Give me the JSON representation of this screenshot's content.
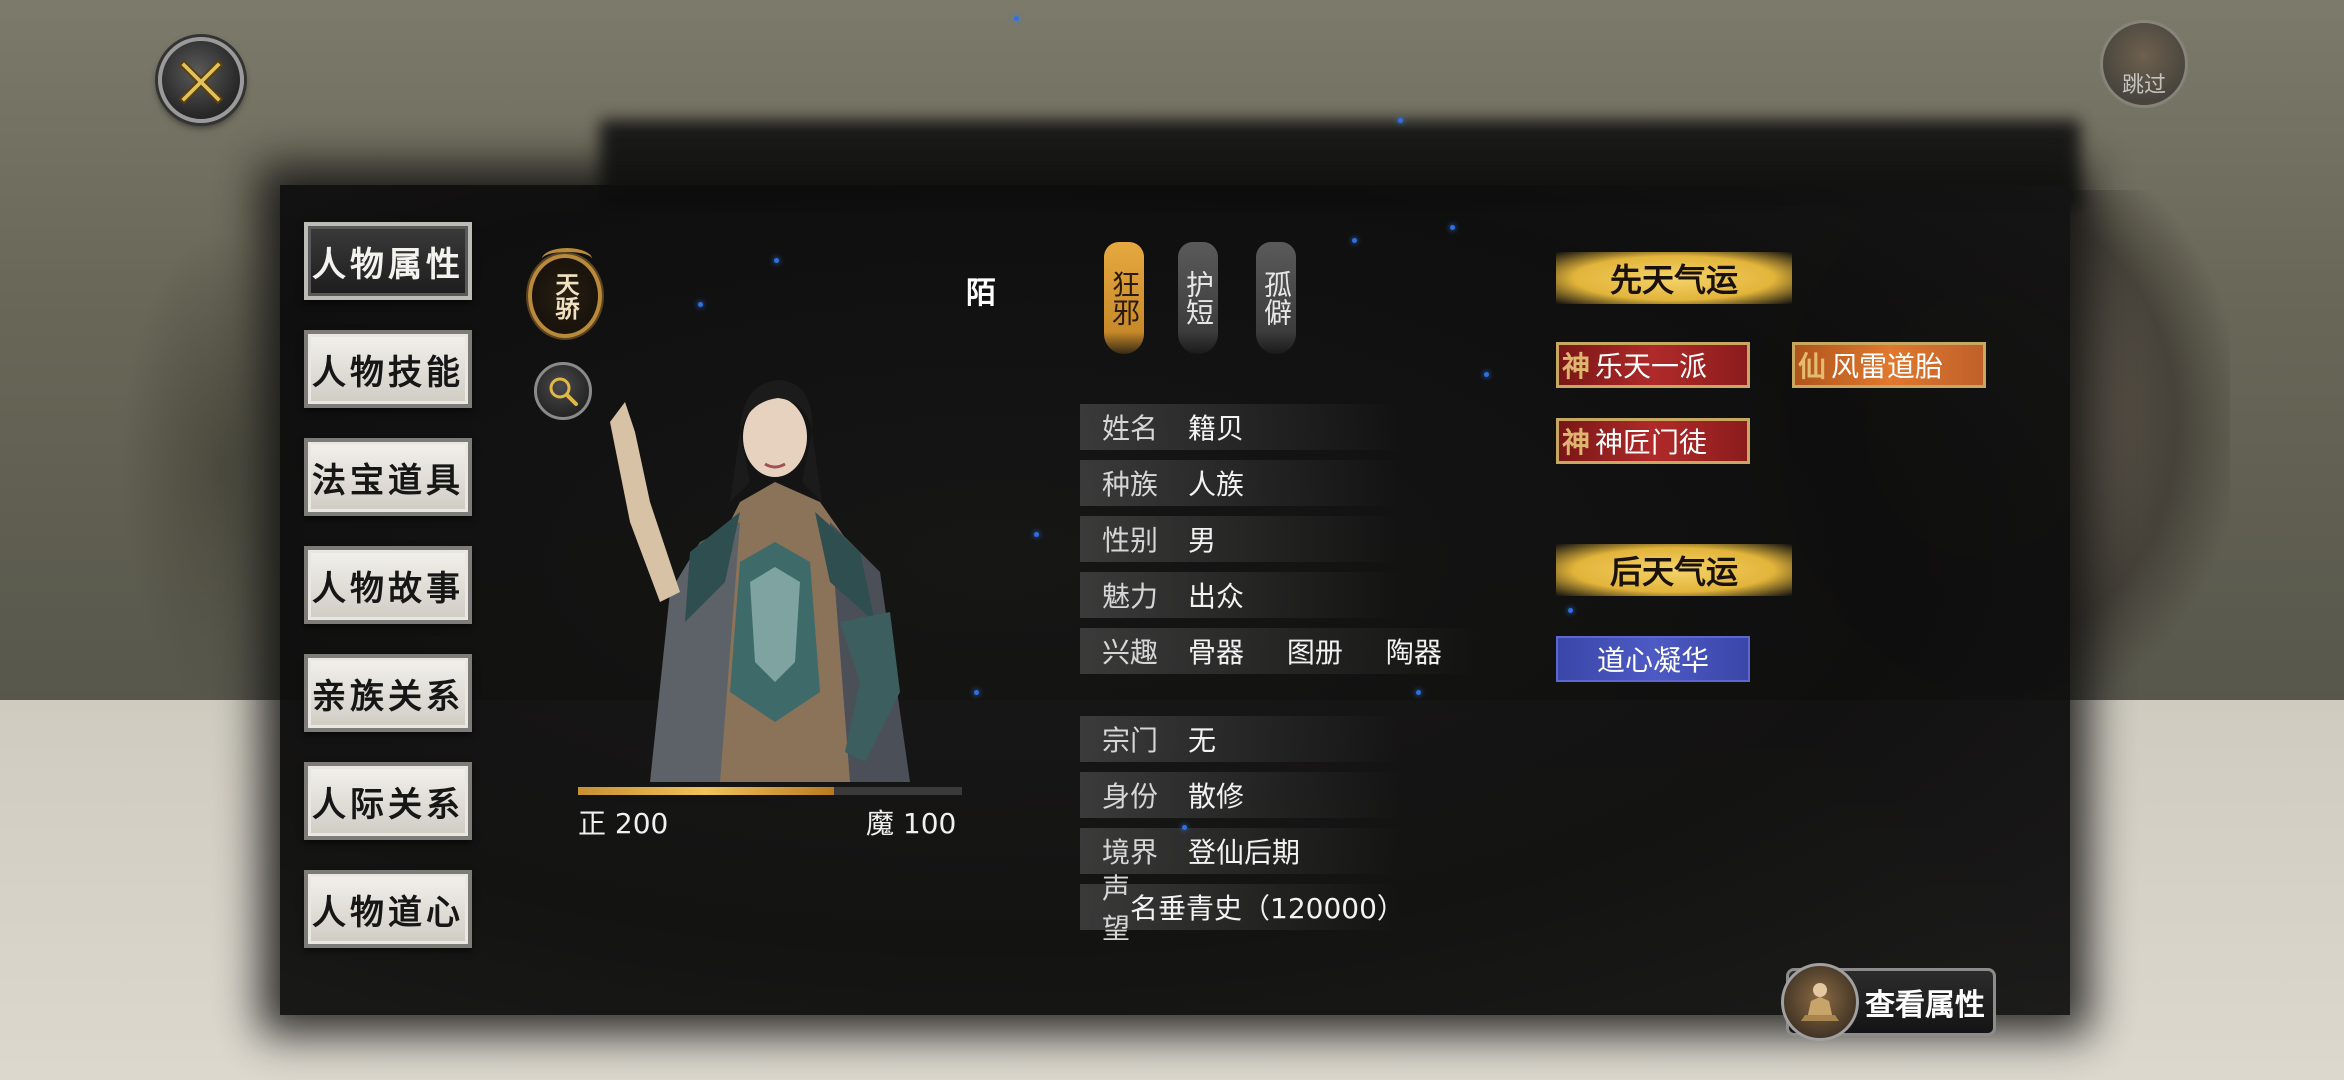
{
  "menu": {
    "items": [
      {
        "label": "人物属性",
        "active": true
      },
      {
        "label": "人物技能",
        "active": false
      },
      {
        "label": "法宝道具",
        "active": false
      },
      {
        "label": "人物故事",
        "active": false
      },
      {
        "label": "亲族关系",
        "active": false
      },
      {
        "label": "人际关系",
        "active": false
      },
      {
        "label": "人物道心",
        "active": false
      }
    ]
  },
  "header": {
    "skip_label": "跳过",
    "badge_label": "天骄",
    "surname_glyph": "陌"
  },
  "morality": {
    "left_label": "正 200",
    "right_label": "魔 100",
    "left_value": 200,
    "right_value": 100
  },
  "traits": [
    {
      "label": "狂邪",
      "style": "gold"
    },
    {
      "label": "护短",
      "style": "gray"
    },
    {
      "label": "孤僻",
      "style": "gray"
    }
  ],
  "info": {
    "rows": [
      {
        "label": "姓名",
        "value": "籍贝"
      },
      {
        "label": "种族",
        "value": "人族"
      },
      {
        "label": "性别",
        "value": "男"
      },
      {
        "label": "魅力",
        "value": "出众"
      },
      {
        "label": "兴趣",
        "values": [
          "骨器",
          "图册",
          "陶器"
        ]
      },
      {
        "label": "宗门",
        "value": "无"
      },
      {
        "label": "身份",
        "value": "散修"
      },
      {
        "label": "境界",
        "value": "登仙后期"
      },
      {
        "label": "声望",
        "value": "名垂青史（120000）"
      }
    ]
  },
  "fortune": {
    "innate_title": "先天气运",
    "innate_tags": [
      {
        "glyph": "神",
        "label": "乐天一派",
        "color": "red"
      },
      {
        "glyph": "仙",
        "label": "风雷道胎",
        "color": "orange"
      },
      {
        "glyph": "神",
        "label": "神匠门徒",
        "color": "red"
      }
    ],
    "acquired_title": "后天气运",
    "acquired_tags": [
      {
        "label": "道心凝华",
        "color": "blue"
      }
    ]
  },
  "view_attributes_label": "查看属性",
  "colors": {
    "gold_accent": "#e2b43a",
    "red_tag": "#b02a2a",
    "orange_tag": "#e0782e",
    "blue_tag": "#4d5ac4",
    "panel_bg": "#0d0d0d"
  }
}
